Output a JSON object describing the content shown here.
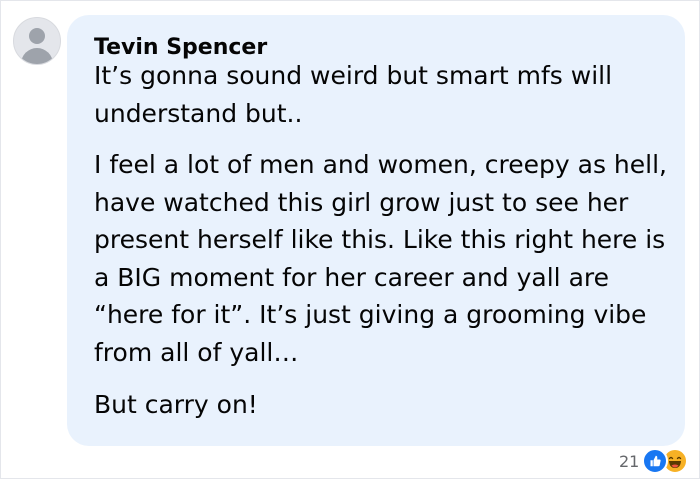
{
  "comment": {
    "author": "Tevin Spencer",
    "paragraphs": [
      "It’s gonna sound weird but smart mfs will understand but..",
      "I feel a lot of men and women, creepy as hell, have watched this girl grow just to see her present herself like this. Like this right here is a BIG moment for her career and yall are “here for it”. It’s just giving a grooming vibe from all of yall…",
      "But carry on!"
    ],
    "reactions": {
      "count": "21",
      "icons": [
        "like-icon",
        "haha-icon"
      ]
    }
  },
  "colors": {
    "bubble": "#e9f2fd",
    "like": "#1877f2",
    "haha": "#f7b125",
    "text": "#050505",
    "muted": "#65676b"
  }
}
